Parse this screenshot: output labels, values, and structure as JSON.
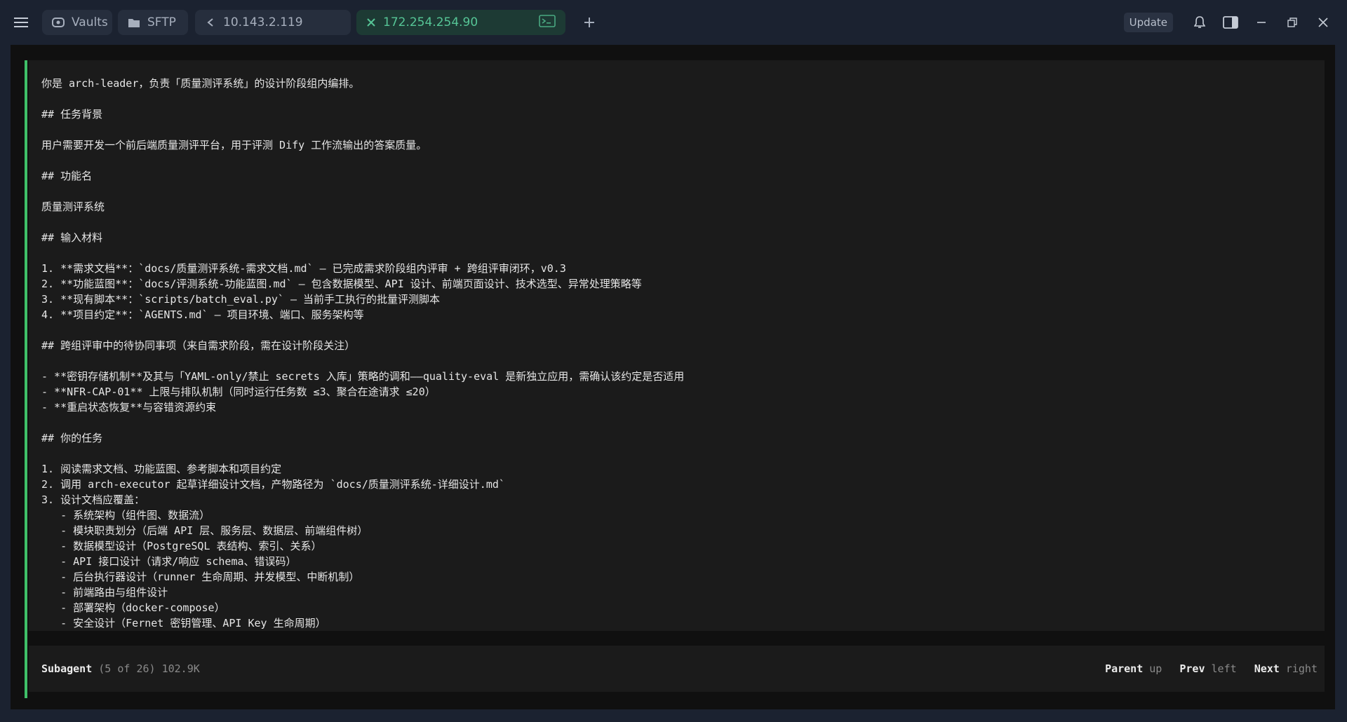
{
  "topbar": {
    "tabs": [
      {
        "label": "Vaults"
      },
      {
        "label": "SFTP"
      },
      {
        "label": "10.143.2.119"
      },
      {
        "label": "172.254.254.90"
      }
    ],
    "update_label": "Update"
  },
  "prompt_lines": [
    "你是 arch-leader，负责「质量测评系统」的设计阶段组内编排。",
    "",
    "## 任务背景",
    "",
    "用户需要开发一个前后端质量测评平台，用于评测 Dify 工作流输出的答案质量。",
    "",
    "## 功能名",
    "",
    "质量测评系统",
    "",
    "## 输入材料",
    "",
    "1. **需求文档**：`docs/质量测评系统-需求文档.md` — 已完成需求阶段组内评审 + 跨组评审闭环，v0.3",
    "2. **功能蓝图**：`docs/评测系统-功能蓝图.md` — 包含数据模型、API 设计、前端页面设计、技术选型、异常处理策略等",
    "3. **现有脚本**：`scripts/batch_eval.py` — 当前手工执行的批量评测脚本",
    "4. **项目约定**：`AGENTS.md` — 项目环境、端口、服务架构等",
    "",
    "## 跨组评审中的待协同事项（来自需求阶段，需在设计阶段关注）",
    "",
    "- **密钥存储机制**及其与「YAML-only/禁止 secrets 入库」策略的调和——quality-eval 是新独立应用，需确认该约定是否适用",
    "- **NFR-CAP-01** 上限与排队机制（同时运行任务数 ≤3、聚合在途请求 ≤20）",
    "- **重启状态恢复**与容错资源约束",
    "",
    "## 你的任务",
    "",
    "1. 阅读需求文档、功能蓝图、参考脚本和项目约定",
    "2. 调用 arch-executor 起草详细设计文档，产物路径为 `docs/质量测评系统-详细设计.md`",
    "3. 设计文档应覆盖：",
    "   - 系统架构（组件图、数据流）",
    "   - 模块职责划分（后端 API 层、服务层、数据层、前端组件树）",
    "   - 数据模型设计（PostgreSQL 表结构、索引、关系）",
    "   - API 接口设计（请求/响应 schema、错误码）",
    "   - 后台执行器设计（runner 生命周期、并发模型、中断机制）",
    "   - 前端路由与组件设计",
    "   - 部署架构（docker-compose）",
    "   - 安全设计（Fernet 密钥管理、API Key 生命周期）"
  ],
  "status": {
    "title": "Subagent",
    "detail": "(5 of 26) 102.9K",
    "parent_label": "Parent",
    "parent_key": "up",
    "prev_label": "Prev",
    "prev_key": "left",
    "next_label": "Next",
    "next_key": "right"
  }
}
